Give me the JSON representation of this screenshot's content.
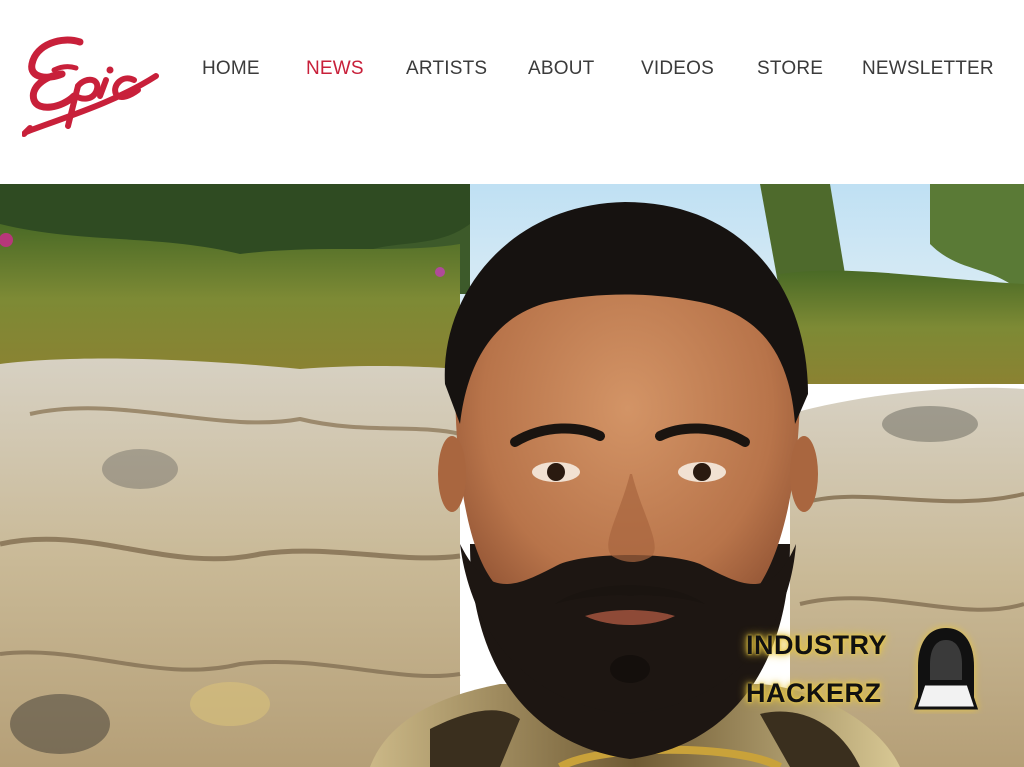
{
  "brand": {
    "logo_text": "Epic",
    "color": "#c8203a"
  },
  "nav": {
    "items": [
      {
        "label": "HOME",
        "active": false
      },
      {
        "label": "NEWS",
        "active": true
      },
      {
        "label": "ARTISTS",
        "active": false
      },
      {
        "label": "ABOUT",
        "active": false
      },
      {
        "label": "VIDEOS",
        "active": false
      },
      {
        "label": "STORE",
        "active": false
      },
      {
        "label": "NEWSLETTER",
        "active": false
      }
    ],
    "text_color": "#3b3b3b",
    "active_color": "#c8203a"
  },
  "hero": {
    "image": "photo of bearded man in front of a stone wall with greenery"
  },
  "watermark": {
    "line1": "INDUSTRY",
    "line2": "HACKERZ",
    "icon": "hooded-hacker-laptop-icon",
    "glow_color": "#e7c640"
  }
}
